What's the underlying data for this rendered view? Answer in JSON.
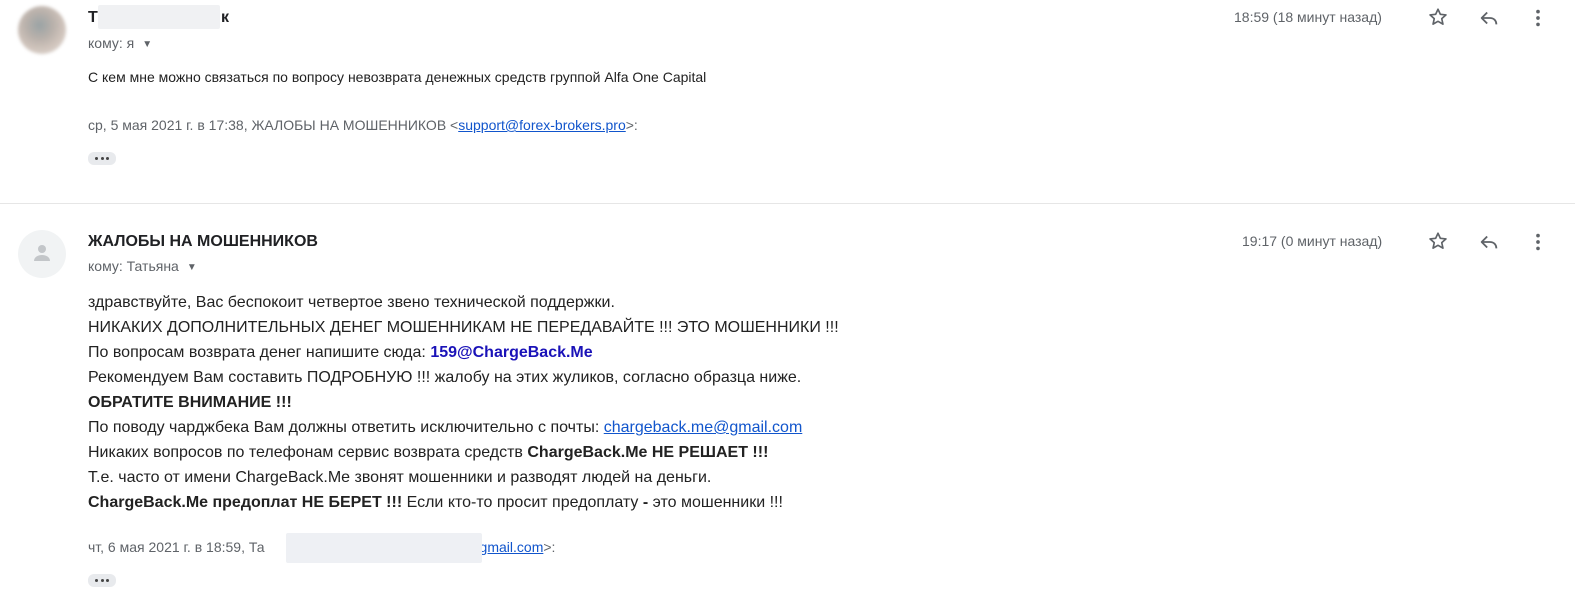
{
  "messages": [
    {
      "sender_start": "Т",
      "sender_end": "к",
      "to_label": "кому: я",
      "time": "18:59 (18 минут назад)",
      "body": "С кем мне можно  связаться  по вопросу невозврата  денежных  средств группой Alfa One Capital",
      "quote_prefix": "ср, 5 мая 2021 г. в 17:38, ЖАЛОБЫ НА МОШЕННИКОВ <",
      "quote_email": "support@forex-brokers.pro",
      "quote_suffix": ">:"
    },
    {
      "sender": "ЖАЛОБЫ НА МОШЕННИКОВ",
      "to_label": "кому: Татьяна",
      "time": "19:17 (0 минут назад)",
      "lines": {
        "l1": "здравствуйте, Вас беспокоит четвертое звено технической поддержки.",
        "l2": "НИКАКИХ ДОПОЛНИТЕЛЬНЫХ ДЕНЕГ МОШЕННИКАМ НЕ ПЕРЕДАВАЙТЕ !!! ЭТО МОШЕННИКИ !!!",
        "l3_text": "По вопросам возврата денег напишите сюда: ",
        "l3_email": "159@ChargeBack.Me",
        "l4": "Рекомендуем Вам составить ПОДРОБНУЮ !!! жалобу на этих жуликов, согласно образца ниже.",
        "l5": "ОБРАТИТЕ ВНИМАНИЕ !!!",
        "l6_text": "По поводу чарджбека Вам должны ответить исключительно с почты: ",
        "l6_email": "chargeback.me@gmail.com",
        "l7_text": "Никаких вопросов по телефонам сервис возврата средств ",
        "l7_bold": "ChargeBack.Me НЕ РЕШАЕТ !!!",
        "l8": "Т.е. часто от имени ChargeBack.Me звонят мошенники и разводят людей на деньги.",
        "l9_bold": "ChargeBack.Me предоплат НЕ БЕРЕТ !!!",
        "l9_text": " Если кто-то просит предоплату ",
        "l9_dash": "-",
        "l9_end": " это мошенники !!!"
      },
      "quote_prefix": "чт, 6 мая 2021 г. в 18:59, Та",
      "quote_email_tail": "1@gmail.com",
      "quote_suffix": ">:"
    }
  ],
  "icons": [
    "star-icon",
    "reply-icon",
    "more-vert-icon",
    "person-icon"
  ]
}
